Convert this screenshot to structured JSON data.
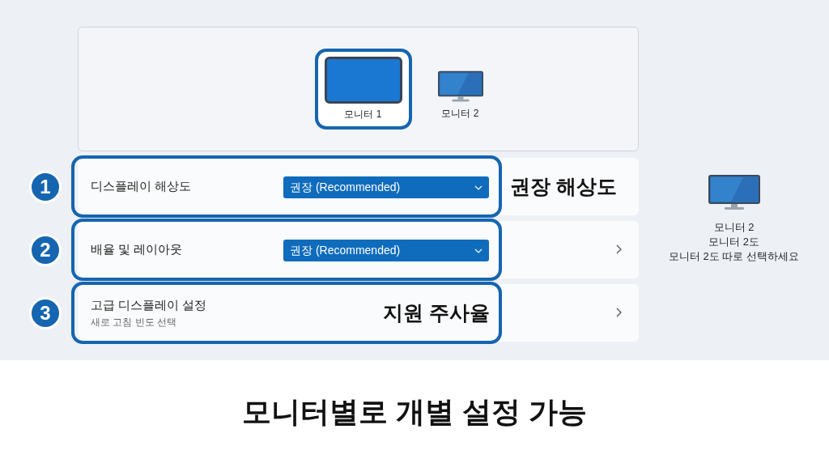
{
  "monitors": [
    {
      "label": "모니터 1",
      "selected": true
    },
    {
      "label": "모니터 2",
      "selected": false
    }
  ],
  "settings": [
    {
      "number": "1",
      "label": "디스플레이 해상도",
      "dropdown": "권장 (Recommended)",
      "chevron": false,
      "note": "권장 해상도",
      "note_inside": false
    },
    {
      "number": "2",
      "label": "배율 및 레이아웃",
      "dropdown": "권장 (Recommended)",
      "chevron": true
    },
    {
      "number": "3",
      "label": "고급 디스플레이 설정",
      "sublabel": "새로 고침 빈도 선택",
      "chevron": true,
      "note": "지원 주사율",
      "note_inside": true
    }
  ],
  "side_note": {
    "lines": [
      "모니터 2",
      "모니터 2도",
      "모니터 2도 따로 선택하세요"
    ]
  },
  "caption": "모니터별로 개별 설정 가능"
}
